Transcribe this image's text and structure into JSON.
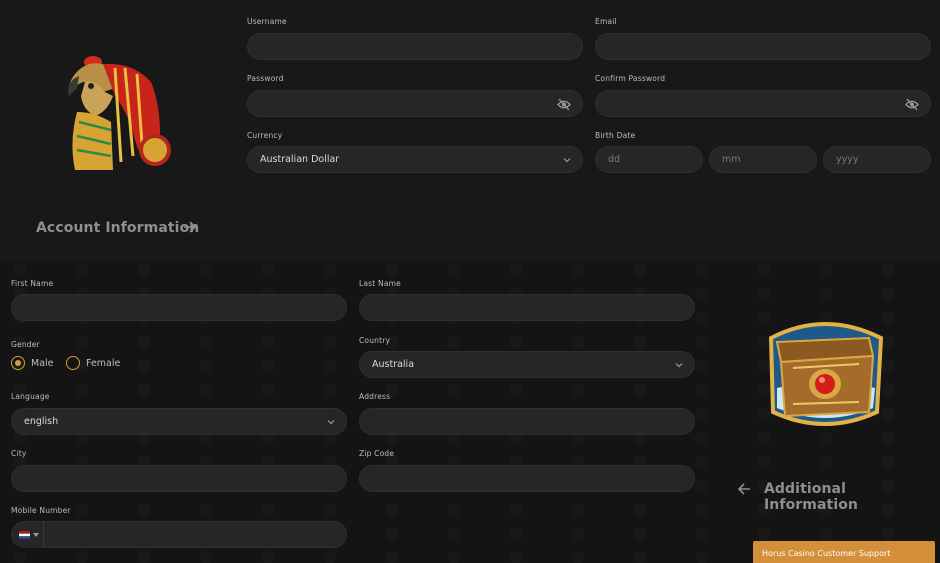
{
  "account": {
    "title": "Account Information",
    "username": {
      "label": "Username",
      "value": ""
    },
    "email": {
      "label": "Email",
      "value": ""
    },
    "password": {
      "label": "Password",
      "value": ""
    },
    "confirm_password": {
      "label": "Confirm Password",
      "value": ""
    },
    "currency": {
      "label": "Currency",
      "value": "Australian Dollar"
    },
    "birth_date": {
      "label": "Birth Date",
      "dd": "dd",
      "mm": "mm",
      "yyyy": "yyyy"
    }
  },
  "additional": {
    "title": "Additional Information",
    "first_name": {
      "label": "First Name",
      "value": ""
    },
    "last_name": {
      "label": "Last Name",
      "value": ""
    },
    "gender": {
      "label": "Gender",
      "options": [
        "Male",
        "Female"
      ],
      "selected": "Male"
    },
    "country": {
      "label": "Country",
      "value": "Australia"
    },
    "language": {
      "label": "Language",
      "value": "english"
    },
    "address": {
      "label": "Address",
      "value": ""
    },
    "city": {
      "label": "City",
      "value": ""
    },
    "zip": {
      "label": "Zip Code",
      "value": ""
    },
    "mobile": {
      "label": "Mobile Number",
      "value": ""
    }
  },
  "support_widget": {
    "label": "Horus Casino Customer Support"
  },
  "colors": {
    "accent": "#d89a3c",
    "field_bg": "#262626",
    "page_bg": "#131313"
  },
  "icons": [
    "horus-falcon-illustration",
    "treasure-chest-illustration",
    "arrow-right-icon",
    "arrow-left-icon",
    "eye-off-icon",
    "chevron-down-icon",
    "netherlands-flag-icon"
  ]
}
